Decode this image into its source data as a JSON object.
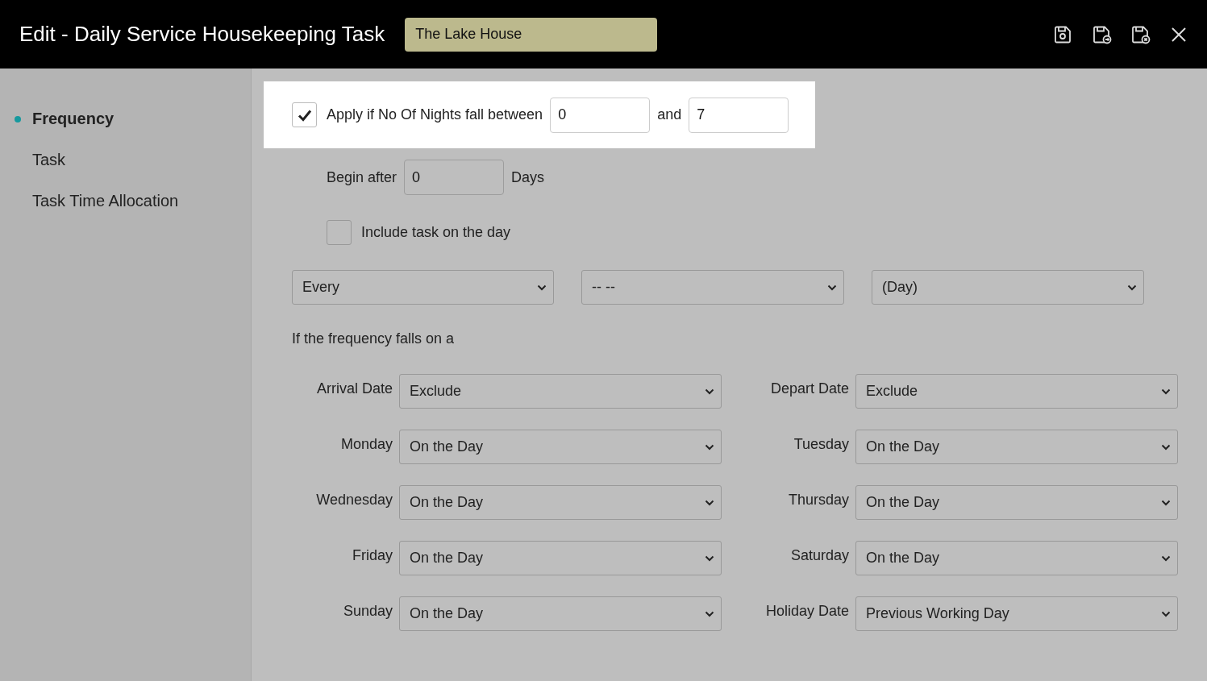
{
  "header": {
    "title": "Edit - Daily Service Housekeeping Task",
    "property": "The Lake House"
  },
  "sidebar": {
    "items": [
      {
        "label": "Frequency",
        "selected": true
      },
      {
        "label": "Task",
        "selected": false
      },
      {
        "label": "Task Time Allocation",
        "selected": false
      }
    ]
  },
  "nights": {
    "checked": true,
    "label": "Apply if No Of Nights fall between",
    "from": "0",
    "joiner": "and",
    "to": "7"
  },
  "begin": {
    "label": "Begin after",
    "value": "0",
    "unit": "Days"
  },
  "include": {
    "checked": false,
    "label": "Include task on the day"
  },
  "frequency_selects": [
    "Every",
    "-- --",
    "(Day)"
  ],
  "rule_heading": "If the frequency falls on a",
  "rules": [
    {
      "label": "Arrival Date",
      "value": "Exclude"
    },
    {
      "label": "Depart Date",
      "value": "Exclude"
    },
    {
      "label": "Monday",
      "value": "On the Day"
    },
    {
      "label": "Tuesday",
      "value": "On the Day"
    },
    {
      "label": "Wednesday",
      "value": "On the Day"
    },
    {
      "label": "Thursday",
      "value": "On the Day"
    },
    {
      "label": "Friday",
      "value": "On the Day"
    },
    {
      "label": "Saturday",
      "value": "On the Day"
    },
    {
      "label": "Sunday",
      "value": "On the Day"
    },
    {
      "label": "Holiday Date",
      "value": "Previous Working Day"
    }
  ]
}
